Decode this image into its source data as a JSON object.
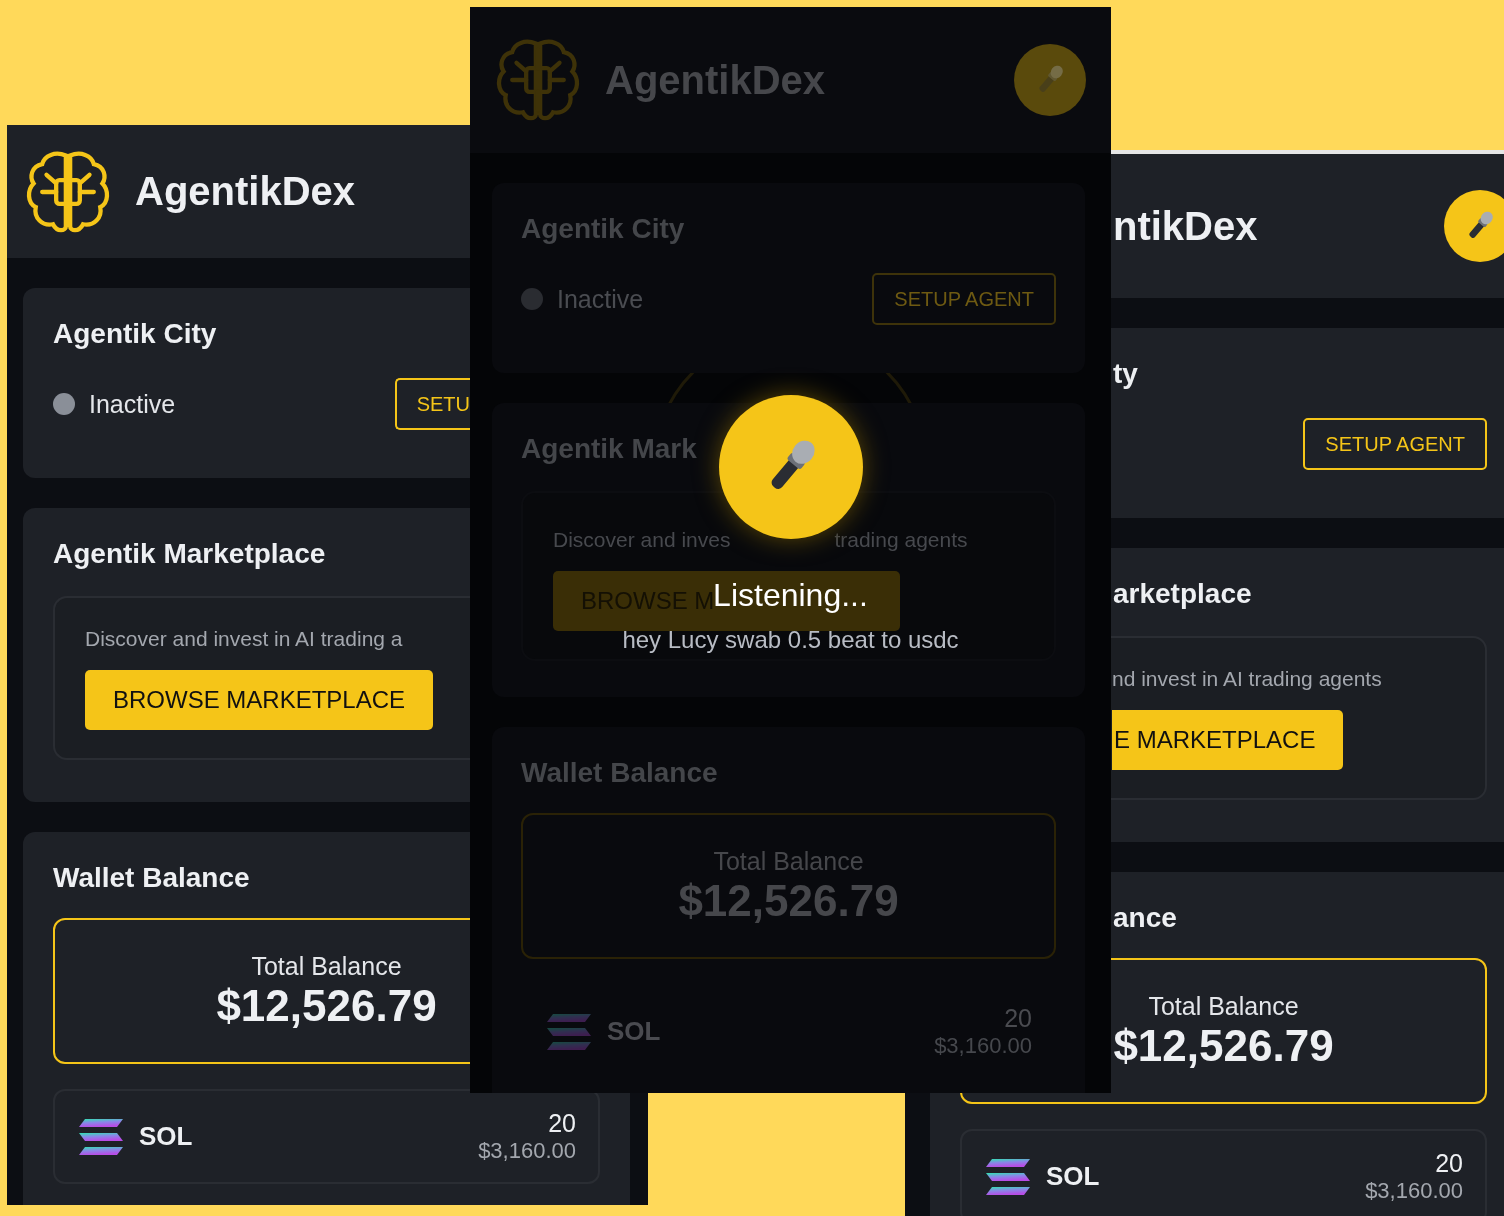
{
  "screens": [
    {
      "dimmed": false,
      "header": {
        "logo": true,
        "title": "AgentikDex",
        "mic": false
      },
      "cards": [
        {
          "kind": "status",
          "title": "Agentik City",
          "status": "Inactive",
          "active": false,
          "button": "SETU"
        },
        {
          "kind": "marketplace",
          "title": "Agentik Marketplace",
          "description": [
            "Discover and invest in AI trading a"
          ],
          "button": "BROWSE MARKETPLACE"
        },
        {
          "kind": "wallet",
          "title": "Wallet Balance",
          "total_label": "Total Balance",
          "total": "$12,526.79",
          "tokens": [
            {
              "symbol": "SOL",
              "amount": "20",
              "value": "$3,160.00"
            }
          ]
        }
      ]
    },
    {
      "dimmed": true,
      "header": {
        "logo": true,
        "title": "AgentikDex",
        "mic": true
      },
      "cards": [
        {
          "kind": "status",
          "title": "Agentik City",
          "status": "Inactive",
          "active": false,
          "button": "SETUP AGENT"
        },
        {
          "kind": "marketplace",
          "title": "Agentik Mark",
          "description": [
            "Discover and inves",
            "trading agents"
          ],
          "button": "BROWSE M"
        },
        {
          "kind": "wallet",
          "title": "Wallet Balance",
          "total_label": "Total Balance",
          "total": "$12,526.79",
          "tokens": [
            {
              "symbol": "SOL",
              "amount": "20",
              "value": "$3,160.00"
            }
          ]
        }
      ],
      "voice_overlay": {
        "status": "Listening...",
        "transcript": "hey Lucy swab 0.5 beat to usdc"
      }
    },
    {
      "dimmed": false,
      "header": {
        "logo": false,
        "title": "ntikDex",
        "mic": true
      },
      "cards": [
        {
          "kind": "status",
          "title": "ty",
          "button": "SETUP AGENT"
        },
        {
          "kind": "marketplace",
          "title": "arketplace",
          "description": [
            "nd invest in AI trading agents"
          ],
          "button": "E MARKETPLACE"
        },
        {
          "kind": "wallet",
          "title": "ance",
          "total_label": "Total Balance",
          "total": "$12,526.79",
          "tokens": [
            {
              "symbol": "SOL",
              "amount": "20",
              "value": "$3,160.00"
            }
          ]
        }
      ]
    }
  ]
}
